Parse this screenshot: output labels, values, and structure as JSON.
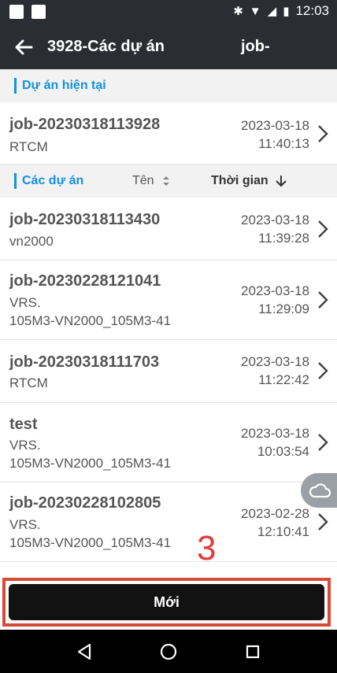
{
  "status_bar": {
    "time": "12:03"
  },
  "topbar": {
    "title": "3928-Các dự án",
    "right_text": "job-"
  },
  "current_section": {
    "label": "Dự án hiện tại"
  },
  "current_project": {
    "name": "job-20230318113928",
    "sub": "RTCM",
    "date": "2023-03-18",
    "time": "11:40:13"
  },
  "list_header": {
    "label": "Các dự án",
    "sort_name": "Tên",
    "sort_time": "Thời gian"
  },
  "projects": [
    {
      "name": "job-20230318113430",
      "sub1": "vn2000",
      "sub2": "",
      "date": "2023-03-18",
      "time": "11:39:28"
    },
    {
      "name": "job-20230228121041",
      "sub1": "VRS.",
      "sub2": "105M3-VN2000_105M3-41",
      "date": "2023-03-18",
      "time": "11:29:09"
    },
    {
      "name": "job-20230318111703",
      "sub1": "RTCM",
      "sub2": "",
      "date": "2023-03-18",
      "time": "11:22:42"
    },
    {
      "name": "test",
      "sub1": "VRS.",
      "sub2": "105M3-VN2000_105M3-41",
      "date": "2023-03-18",
      "time": "10:03:54"
    },
    {
      "name": "job-20230228102805",
      "sub1": "VRS.",
      "sub2": "105M3-VN2000_105M3-41",
      "date": "2023-02-28",
      "time": "12:10:41"
    }
  ],
  "annotation": {
    "step": "3"
  },
  "new_button": {
    "label": "Mới"
  },
  "icons": {
    "back": "arrow-left-icon",
    "chevron": "chevron-right-icon",
    "cloud": "cloud-icon",
    "nav_back": "triangle-back-icon",
    "nav_home": "circle-home-icon",
    "nav_recent": "square-recent-icon"
  },
  "colors": {
    "accent": "#1591e0",
    "annotation": "#e33b3b",
    "highlight_border": "#d64a36"
  }
}
